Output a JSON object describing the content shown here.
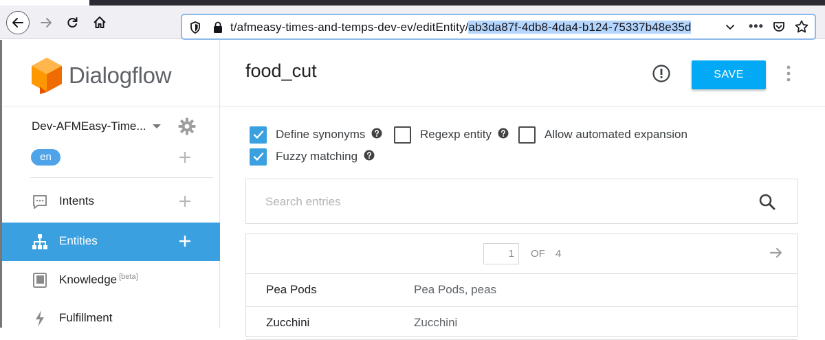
{
  "browser": {
    "url_prefix": "t/afmeasy-times-and-temps-dev-ev/editEntity/",
    "url_selected": "ab3da87f-4db8-4da4-b124-75337b48e35d",
    "icons": [
      "back-arrow-icon",
      "forward-arrow-icon",
      "reload-icon",
      "home-icon",
      "shield-icon",
      "lock-icon",
      "chevron-down-icon",
      "more-icon",
      "pocket-icon",
      "star-icon"
    ]
  },
  "sidebar": {
    "brand": "Dialogflow",
    "agent_name": "Dev-AFMEasy-Time...",
    "language": "en",
    "items": [
      {
        "label": "Intents",
        "icon": "chat-bubble-icon",
        "active": false
      },
      {
        "label": "Entities",
        "icon": "hierarchy-icon",
        "active": true
      },
      {
        "label": "Knowledge",
        "beta": "[beta]",
        "icon": "book-icon",
        "active": false
      },
      {
        "label": "Fulfillment",
        "icon": "bolt-icon",
        "active": false
      }
    ]
  },
  "main": {
    "entity_name": "food_cut",
    "save_label": "SAVE",
    "options": {
      "define_synonyms": {
        "label": "Define synonyms",
        "checked": true
      },
      "regexp_entity": {
        "label": "Regexp entity",
        "checked": false
      },
      "allow_expansion": {
        "label": "Allow automated expansion",
        "checked": false
      },
      "fuzzy_matching": {
        "label": "Fuzzy matching",
        "checked": true
      }
    },
    "search_placeholder": "Search entries",
    "pager": {
      "page": "1",
      "of_label": "OF",
      "total": "4"
    },
    "entries": [
      {
        "value": "Pea Pods",
        "synonyms": "Pea Pods, peas"
      },
      {
        "value": "Zucchini",
        "synonyms": "Zucchini"
      }
    ]
  },
  "colors": {
    "accent": "#3ba0e0",
    "save_button": "#03a9f4",
    "brand_orange": "#ef6c00"
  }
}
